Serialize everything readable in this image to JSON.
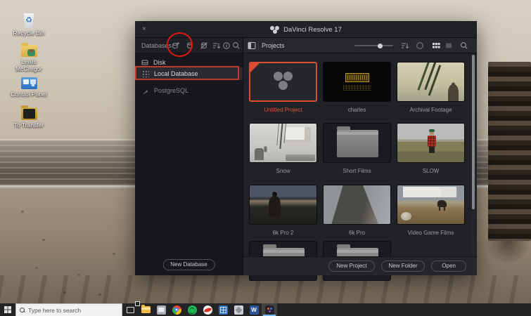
{
  "colors": {
    "selection_red": "#dc4f35",
    "annotation_red": "#e41510",
    "selected_label": "#d7553a",
    "window_bg": "#17181d"
  },
  "desktop": {
    "icons": [
      {
        "name": "recycle-bin",
        "label": "Recycle Bin",
        "glyph": "♻"
      },
      {
        "name": "user-folder",
        "label": "Lewis McGregor"
      },
      {
        "name": "control-panel",
        "label": "Control Panel"
      },
      {
        "name": "to-transfer-folder",
        "label": "To Transfer"
      }
    ]
  },
  "window": {
    "title": "DaVinci Resolve 17",
    "close_label": "×",
    "databases_panel": {
      "header": "Databases",
      "toolbar_icons": [
        "add-database",
        "connect-database",
        "disconnect-database",
        "sort",
        "info",
        "search"
      ],
      "group_disk": "Disk",
      "items": [
        {
          "label": "Local Database",
          "selected": true
        },
        {
          "label": "PostgreSQL",
          "selected": false
        }
      ],
      "new_database_button": "New Database"
    },
    "projects_panel": {
      "header": "Projects",
      "thumbnail_slider_pct": 60,
      "view_icons": [
        "panel-toggle",
        "sort",
        "refresh",
        "grid-view",
        "list-view",
        "search"
      ],
      "active_view": "grid",
      "projects": [
        {
          "name": "Untitled Project",
          "selected": true,
          "thumb": "resolve-logo"
        },
        {
          "name": "charles",
          "selected": false,
          "thumb": "video"
        },
        {
          "name": "Archival Footage",
          "selected": false,
          "thumb": "video"
        },
        {
          "name": "Snow",
          "selected": false,
          "thumb": "video"
        },
        {
          "name": "Short Films",
          "selected": false,
          "thumb": "folder"
        },
        {
          "name": "SLOW",
          "selected": false,
          "thumb": "video"
        },
        {
          "name": "6k Pro 2",
          "selected": false,
          "thumb": "video"
        },
        {
          "name": "6k Pro",
          "selected": false,
          "thumb": "video"
        },
        {
          "name": "Video Game Films",
          "selected": false,
          "thumb": "video"
        }
      ],
      "partial_row_folders": 2,
      "buttons": {
        "new_project": "New Project",
        "new_folder": "New Folder",
        "open": "Open"
      }
    }
  },
  "annotations": {
    "circle_target": "add-database-icon",
    "rect_target": "local-database-item"
  },
  "taskbar": {
    "search_placeholder": "Type here to search",
    "word_glyph": "W",
    "icons": [
      "start",
      "task-view",
      "file-explorer",
      "mail",
      "chrome",
      "spotify",
      "media-player",
      "calculator",
      "photos",
      "word",
      "davinci-resolve"
    ],
    "active_app": "davinci-resolve"
  }
}
